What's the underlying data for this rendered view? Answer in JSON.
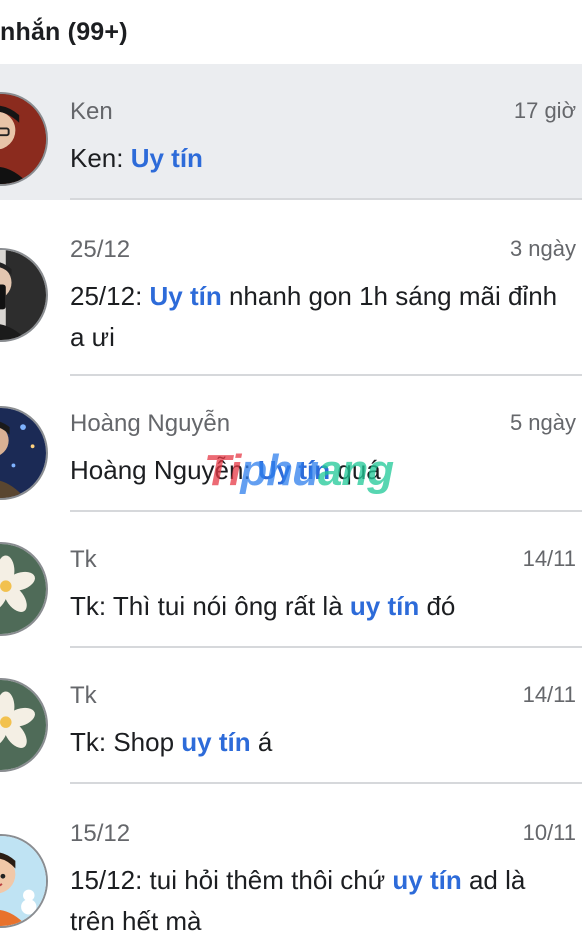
{
  "header": {
    "title": "nhắn (99+)"
  },
  "conversations": [
    {
      "sender": "Ken",
      "time": "17 giờ",
      "prefix": "Ken: ",
      "highlight": "Uy tín",
      "suffix": "",
      "selected": true,
      "avatar": "avatar-ken"
    },
    {
      "sender": "25/12",
      "time": "3 ngày",
      "prefix": "25/12: ",
      "highlight": "Uy tín",
      "suffix": " nhanh gon 1h sáng mãi đỉnh a ưi",
      "selected": false,
      "avatar": "avatar-25-12"
    },
    {
      "sender": "Hoàng Nguyễn",
      "time": "5 ngày",
      "prefix": "Hoàng Nguyễn: ",
      "highlight": "Uy tín",
      "suffix": " quá",
      "selected": false,
      "avatar": "avatar-hoang"
    },
    {
      "sender": "Tk",
      "time": "14/11",
      "prefix": "Tk: Thì tui nói ông rất là ",
      "highlight": "uy tín",
      "suffix": " đó",
      "selected": false,
      "avatar": "avatar-tk-flower"
    },
    {
      "sender": "Tk",
      "time": "14/11",
      "prefix": "Tk: Shop ",
      "highlight": "uy tín",
      "suffix": " á",
      "selected": false,
      "avatar": "avatar-tk-flower"
    },
    {
      "sender": "15/12",
      "time": "10/11",
      "prefix": "15/12: tui hỏi thêm thôi chứ ",
      "highlight": "uy tín",
      "suffix": " ad là trên hết mà",
      "selected": false,
      "avatar": "avatar-15-12"
    }
  ],
  "watermark": {
    "part1": "Ti",
    "part2": "phu",
    "part3": "ang"
  },
  "colors": {
    "highlight": "#2d6bd9",
    "selected_bg": "#ebedf0",
    "muted_text": "#65676b"
  }
}
